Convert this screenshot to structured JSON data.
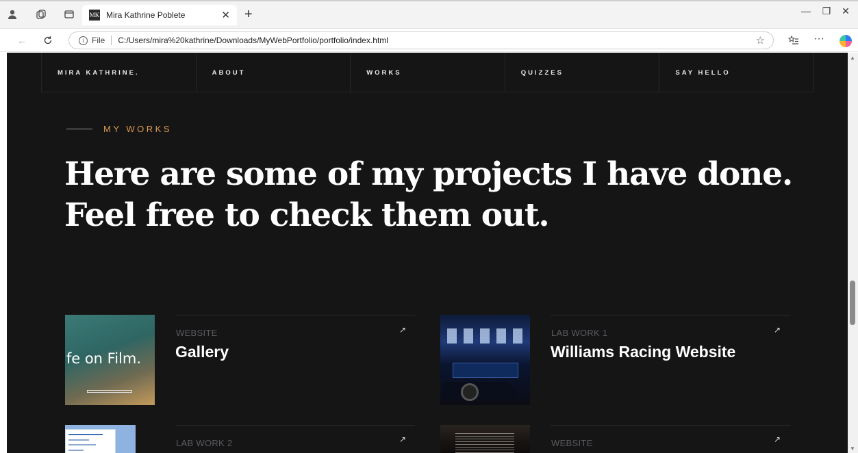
{
  "browser": {
    "tab_title": "Mira Kathrine Poblete",
    "favicon_text": "MK",
    "address_scheme_label": "File",
    "url": "C:/Users/mira%20kathrine/Downloads/MyWebPortfolio/portfolio/index.html",
    "icons": {
      "profile": "profile-icon",
      "workspaces": "workspaces-icon",
      "tab_actions": "tab-actions-icon",
      "back": "back-arrow-icon",
      "refresh": "refresh-icon",
      "favorite": "star-icon",
      "favorites": "favorites-icon",
      "more": "more-icon",
      "copilot": "copilot-icon"
    }
  },
  "nav": {
    "items": [
      "MIRA KATHRINE.",
      "ABOUT",
      "WORKS",
      "QUIZZES",
      "SAY HELLO"
    ]
  },
  "section": {
    "eyebrow": "MY WORKS",
    "headline": "Here are some of my projects I have done. Feel free to check them out."
  },
  "projects": [
    {
      "category": "WEBSITE",
      "title": "Gallery",
      "thumb_text": "ife on Film."
    },
    {
      "category": "LAB WORK 1",
      "title": "Williams Racing Website",
      "thumb_text": ""
    },
    {
      "category": "LAB WORK 2",
      "title": "",
      "thumb_text": ""
    },
    {
      "category": "WEBSITE",
      "title": "",
      "thumb_text": ""
    }
  ],
  "colors": {
    "page_bg": "#151516",
    "accent": "#d99a52",
    "text": "#ffffff",
    "muted": "#5b5b60"
  }
}
